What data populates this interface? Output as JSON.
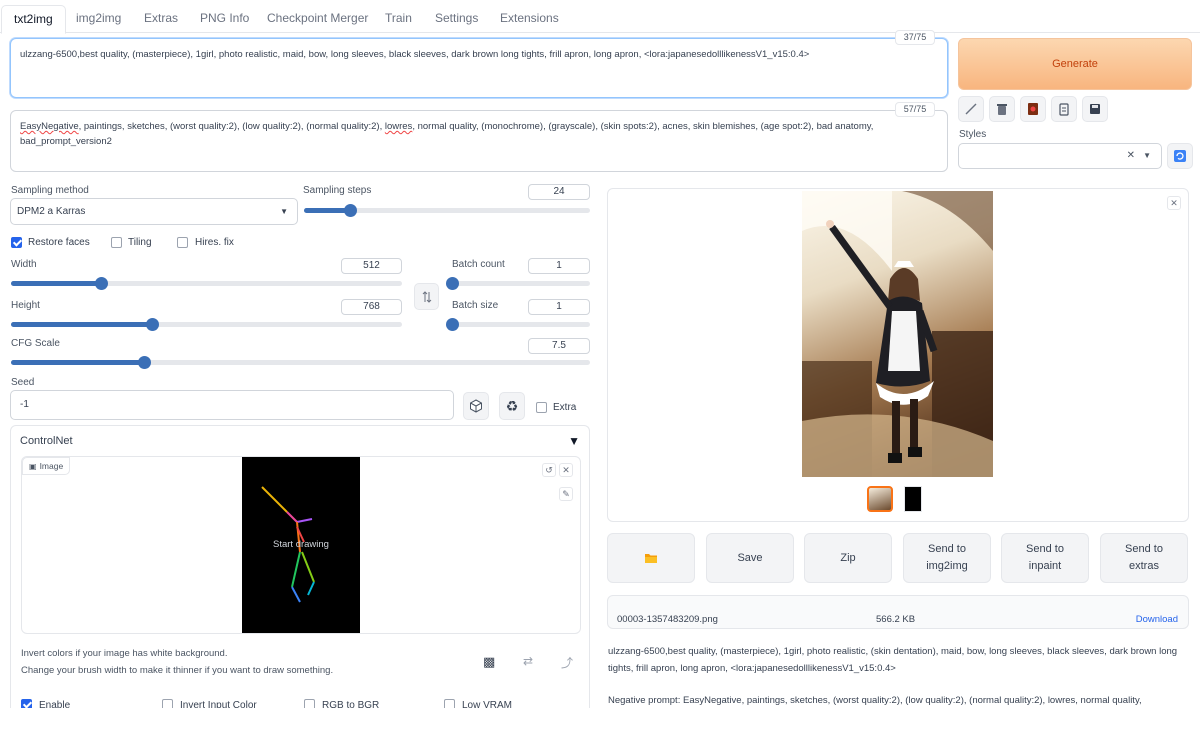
{
  "tabs": [
    {
      "label": "txt2img",
      "active": true
    },
    {
      "label": "img2img"
    },
    {
      "label": "Extras"
    },
    {
      "label": "PNG Info"
    },
    {
      "label": "Checkpoint Merger"
    },
    {
      "label": "Train"
    },
    {
      "label": "Settings"
    },
    {
      "label": "Extensions"
    }
  ],
  "prompt": {
    "text": "ulzzang-6500,best quality, (masterpiece), 1girl, photo realistic, maid, bow, long sleeves, black sleeves, dark brown long tights, frill apron, long apron, <lora:japanesedolllikenessV1_v15:0.4>",
    "counter": "37/75"
  },
  "negative_prompt": {
    "first_word": "EasyNegative",
    "text_a": ", paintings, sketches, (worst quality:2), (low quality:2), (normal quality:2), ",
    "underlined": "lowres",
    "text_b": ", normal quality, (monochrome), (grayscale), (skin spots:2), acnes, skin blemishes, (age spot:2), bad anatomy, bad_prompt_version2",
    "counter": "57/75"
  },
  "generate_label": "Generate",
  "styles_label": "Styles",
  "sampling": {
    "method_label": "Sampling method",
    "method_value": "DPM2 a Karras",
    "steps_label": "Sampling steps",
    "steps_value": "24"
  },
  "options": {
    "restore_faces": "Restore faces",
    "tiling": "Tiling",
    "hires_fix": "Hires. fix"
  },
  "width": {
    "label": "Width",
    "value": "512",
    "fraction": 0.23
  },
  "height": {
    "label": "Height",
    "value": "768",
    "fraction": 0.36
  },
  "batch_count": {
    "label": "Batch count",
    "value": "1",
    "fraction": 0.0
  },
  "batch_size": {
    "label": "Batch size",
    "value": "1",
    "fraction": 0.0
  },
  "cfg": {
    "label": "CFG Scale",
    "value": "7.5",
    "fraction": 0.23
  },
  "steps_fraction": 0.16,
  "seed": {
    "label": "Seed",
    "value": "-1",
    "extra_label": "Extra"
  },
  "controlnet": {
    "title": "ControlNet",
    "image_label": "Image",
    "start_drawing": "Start drawing",
    "help_line1": "Invert colors if your image has white background.",
    "help_line2": "Change your brush width to make it thinner if you want to draw something.",
    "enable": "Enable",
    "invert": "Invert Input Color",
    "rgb": "RGB to BGR",
    "lowvram": "Low VRAM"
  },
  "output_buttons": {
    "save": "Save",
    "zip": "Zip",
    "send_img2img": "Send to\nimg2img",
    "send_inpaint": "Send to\ninpaint",
    "send_extras": "Send to\nextras"
  },
  "file": {
    "name": "00003-1357483209.png",
    "size": "566.2 KB",
    "download": "Download"
  },
  "info": {
    "prompt": "ulzzang-6500,best quality, (masterpiece), 1girl, photo realistic, (skin dentation), maid, bow, long sleeves, black sleeves, dark brown long tights, frill apron, long apron, <lora:japanesedolllikenessV1_v15:0.4>",
    "negative": "Negative prompt: EasyNegative, paintings, sketches, (worst quality:2), (low quality:2), (normal quality:2), lowres, normal quality,"
  },
  "colors": {
    "accent": "#3b6fb6",
    "generate_text": "#c2410c",
    "link": "#2563eb"
  }
}
